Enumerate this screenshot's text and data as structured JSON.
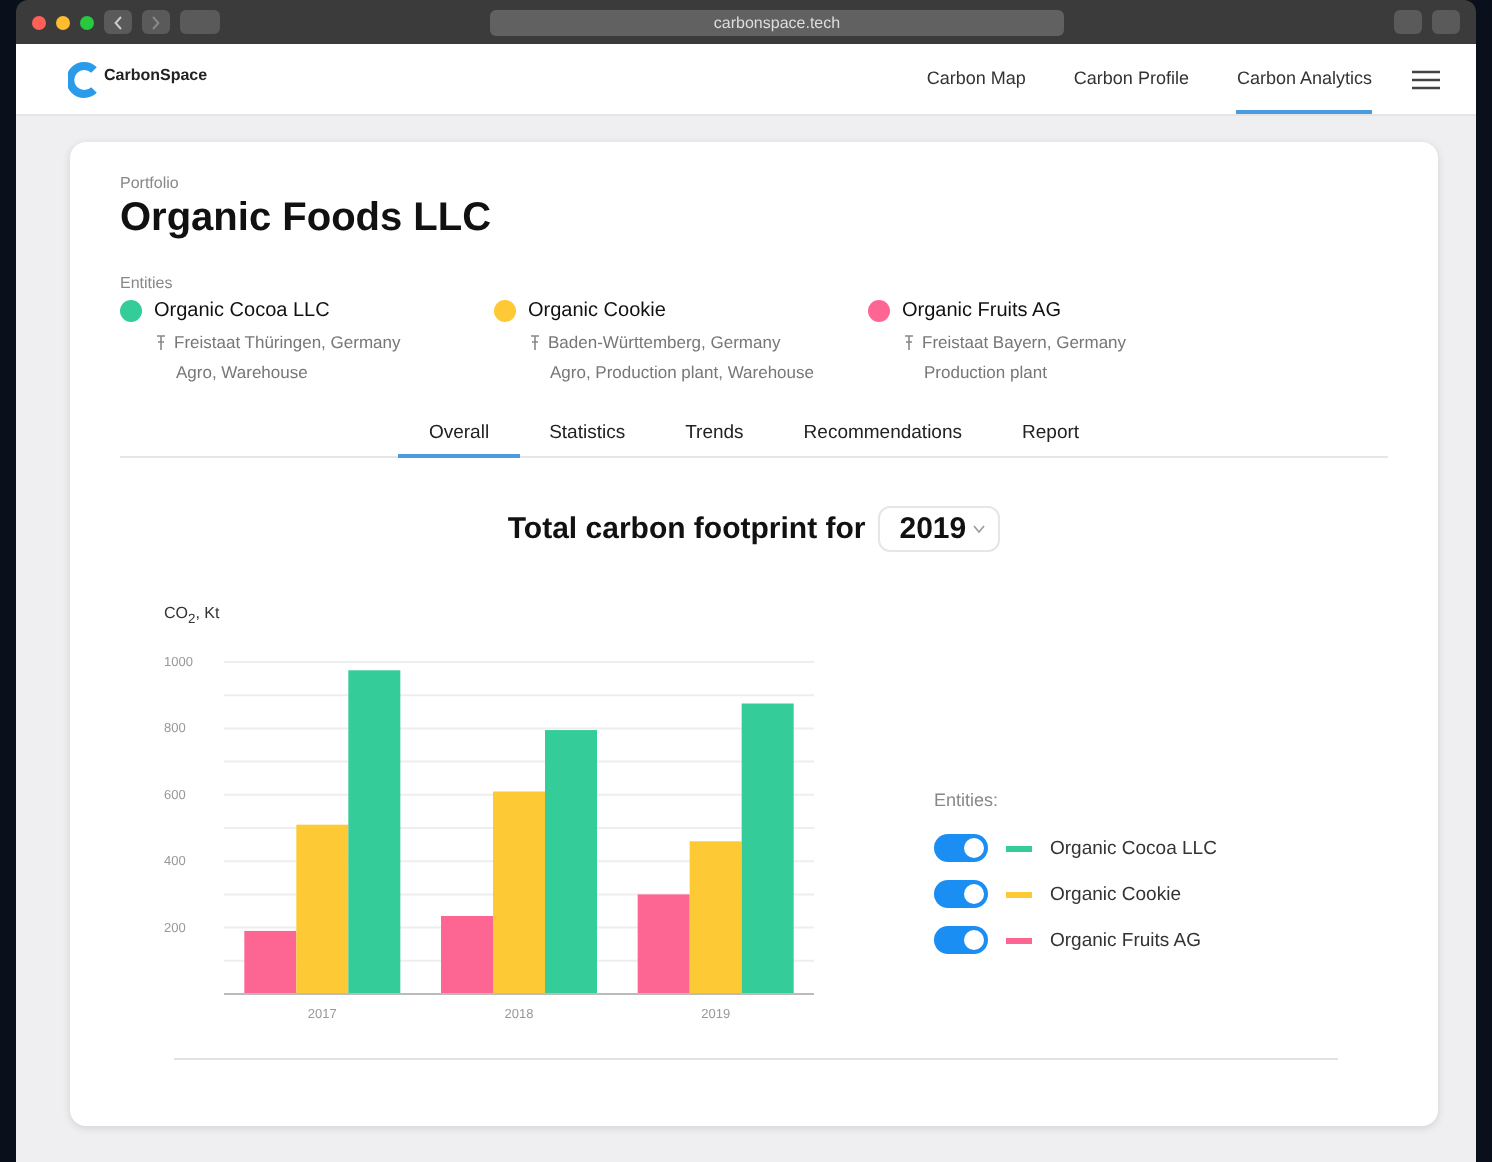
{
  "browser": {
    "url": "carbonspace.tech"
  },
  "header": {
    "logo": "CarbonSpace",
    "nav": [
      {
        "label": "Carbon Map",
        "selected": false
      },
      {
        "label": "Carbon Profile",
        "selected": false
      },
      {
        "label": "Carbon Analytics",
        "selected": true
      }
    ]
  },
  "portfolio": {
    "label": "Portfolio",
    "title": "Organic Foods LLC"
  },
  "entities": {
    "label": "Entities",
    "items": [
      {
        "name": "Organic Cocoa LLC",
        "color": "#34cc98",
        "location": "Freistaat Thüringen, Germany",
        "types": "Agro, Warehouse"
      },
      {
        "name": "Organic Cookie",
        "color": "#fdc935",
        "location": "Baden-Württemberg, Germany",
        "types": "Agro, Production plant, Warehouse"
      },
      {
        "name": "Organic Fruits AG",
        "color": "#fd6593",
        "location": "Freistaat Bayern, Germany",
        "types": "Production plant"
      }
    ]
  },
  "tabs": [
    {
      "label": "Overall",
      "selected": true
    },
    {
      "label": "Statistics",
      "selected": false
    },
    {
      "label": "Trends",
      "selected": false
    },
    {
      "label": "Recommendations",
      "selected": false
    },
    {
      "label": "Report",
      "selected": false
    }
  ],
  "footprint": {
    "title": "Total carbon footprint for",
    "year": "2019"
  },
  "chart_data": {
    "type": "bar",
    "grid": true,
    "ylabel": "CO$_{2}$, Kt",
    "categories": [
      "2017",
      "2018",
      "2019"
    ],
    "ylim": [
      0,
      1000
    ],
    "yticks": [
      200,
      400,
      600,
      800,
      1000
    ],
    "series": [
      {
        "name": "Organic Fruits AG",
        "color": "#fd6593",
        "values": [
          190,
          235,
          300
        ]
      },
      {
        "name": "Organic Cookie",
        "color": "#fdc935",
        "values": [
          510,
          610,
          460
        ]
      },
      {
        "name": "Organic Cocoa LLC",
        "color": "#34cc98",
        "values": [
          975,
          795,
          875
        ]
      }
    ]
  },
  "legend": {
    "label": "Entities:",
    "toggles": [
      {
        "on": true
      },
      {
        "on": true
      },
      {
        "on": true
      }
    ]
  }
}
